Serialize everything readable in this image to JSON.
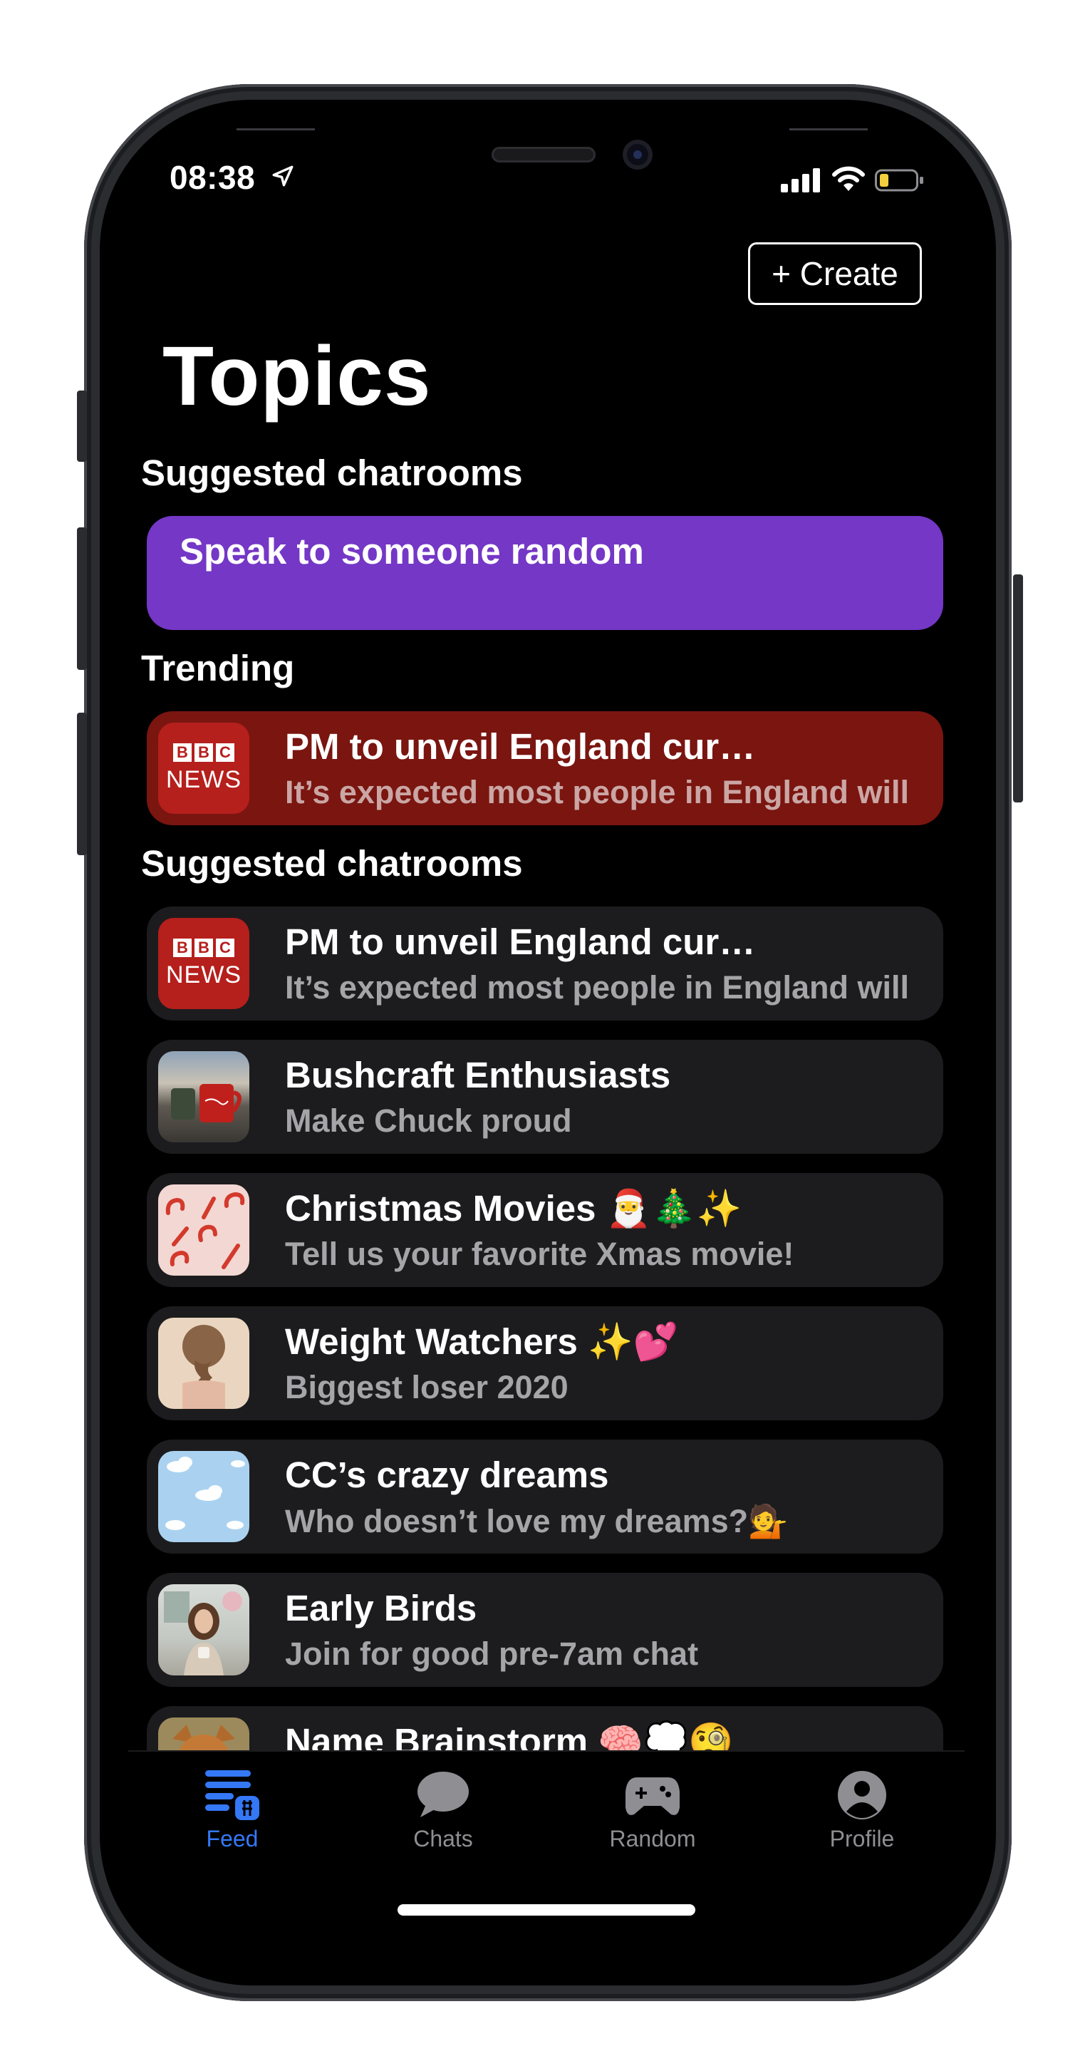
{
  "status_bar": {
    "time": "08:38"
  },
  "header": {
    "create_label": "+ Create",
    "title": "Topics"
  },
  "sections": {
    "suggested_top": "Suggested chatrooms",
    "trending": "Trending",
    "suggested_list": "Suggested chatrooms"
  },
  "random_card": {
    "label": "Speak to someone random"
  },
  "trending_item": {
    "title": "PM to unveil England cur…",
    "subtitle": "It’s expected most people in England will"
  },
  "chatrooms": [
    {
      "title": "PM to unveil England cur…",
      "subtitle": "It’s expected most people in England will",
      "thumb": "bbc-news"
    },
    {
      "title": "Bushcraft Enthusiasts",
      "subtitle": "Make Chuck proud",
      "thumb": "mugs-photo"
    },
    {
      "title": "Christmas Movies 🎅🎄✨",
      "subtitle": "Tell us your favorite Xmas movie!",
      "thumb": "candy-cane-pattern"
    },
    {
      "title": "Weight Watchers ✨💕",
      "subtitle": "Biggest loser 2020",
      "thumb": "braid-photo"
    },
    {
      "title": "CC’s crazy dreams",
      "subtitle": "Who doesn’t love my dreams?💁",
      "thumb": "sky-clouds"
    },
    {
      "title": "Early Birds",
      "subtitle": "Join for good pre-7am chat",
      "thumb": "woman-coffee-photo"
    },
    {
      "title": "Name Brainstorm 🧠💭🧐",
      "subtitle": "",
      "thumb": "dog-photo"
    }
  ],
  "bbc_logo": {
    "letters": [
      "B",
      "B",
      "C"
    ],
    "word": "NEWS"
  },
  "tabs": [
    {
      "label": "Feed",
      "icon": "feed-icon",
      "active": true
    },
    {
      "label": "Chats",
      "icon": "chat-bubble-icon",
      "active": false
    },
    {
      "label": "Random",
      "icon": "gamepad-icon",
      "active": false
    },
    {
      "label": "Profile",
      "icon": "profile-icon",
      "active": false
    }
  ],
  "colors": {
    "background": "#000000",
    "random_card": "#7437c6",
    "trending_card": "#7a1510",
    "list_card": "#1c1c1e",
    "active_tab": "#3478f6",
    "inactive_tab": "#8e8e93"
  }
}
